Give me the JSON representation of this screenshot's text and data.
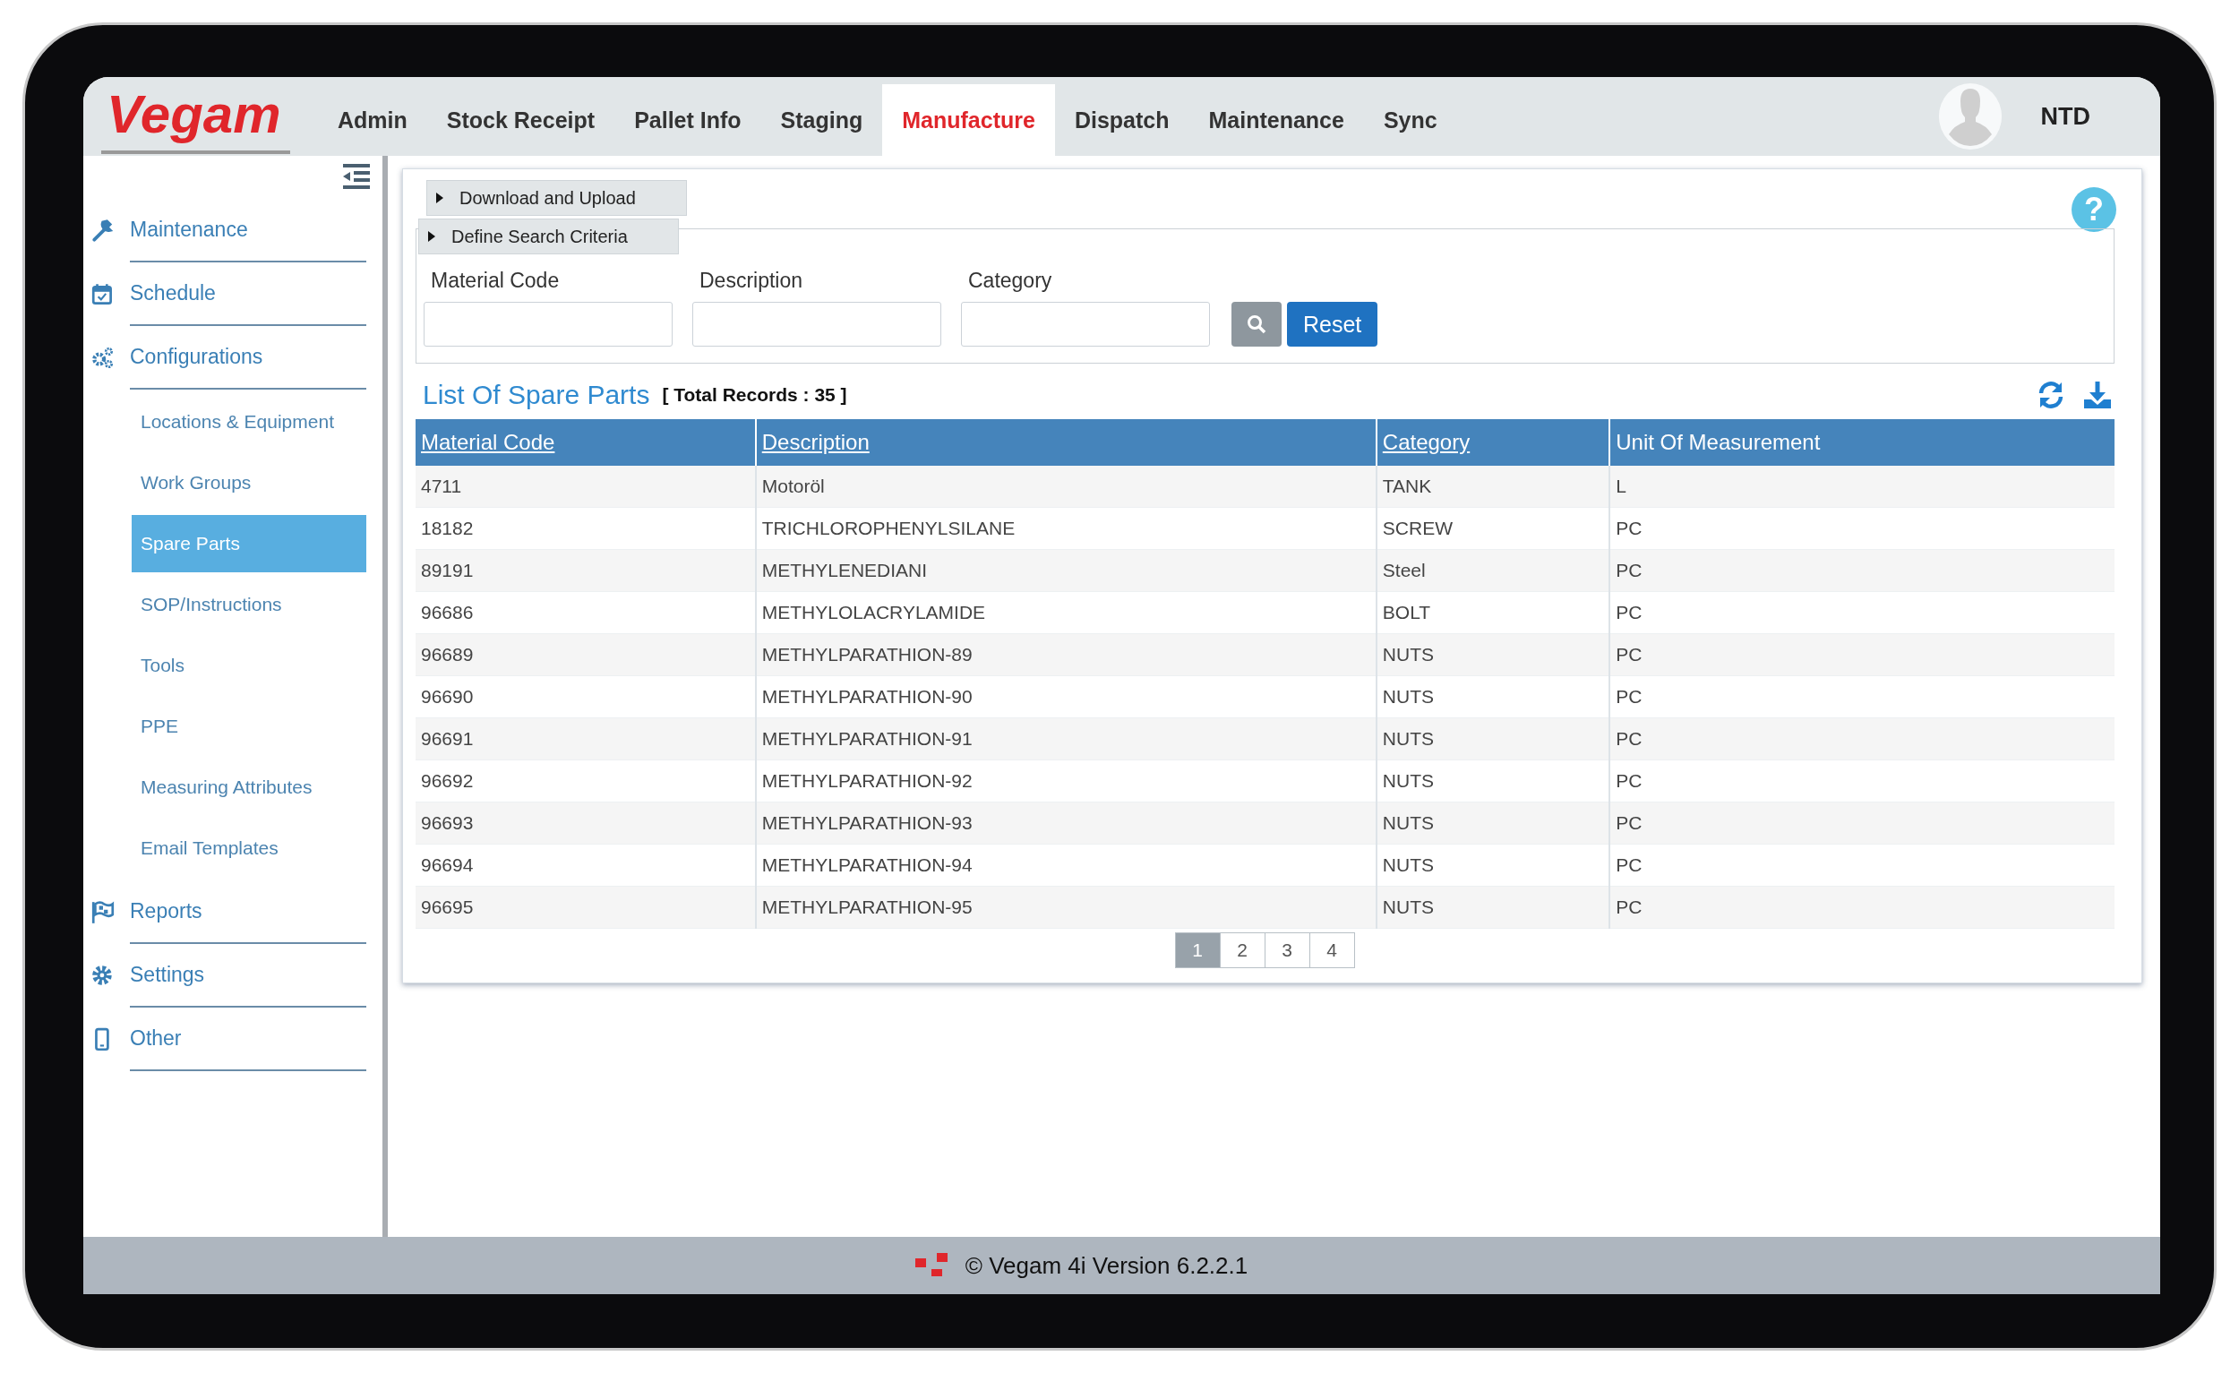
{
  "header": {
    "logo": "Vegam",
    "tabs": [
      {
        "label": "Admin",
        "selected": false
      },
      {
        "label": "Stock Receipt",
        "selected": false
      },
      {
        "label": "Pallet Info",
        "selected": false
      },
      {
        "label": "Staging",
        "selected": false
      },
      {
        "label": "Manufacture",
        "selected": true
      },
      {
        "label": "Dispatch",
        "selected": false
      },
      {
        "label": "Maintenance",
        "selected": false
      },
      {
        "label": "Sync",
        "selected": false
      }
    ],
    "user": "NTD"
  },
  "sidebar": {
    "items": [
      {
        "label": "Maintenance",
        "selected": false
      },
      {
        "label": "Schedule",
        "selected": false
      },
      {
        "label": "Configurations",
        "selected": false,
        "children": [
          {
            "label": "Locations & Equipment",
            "selected": false
          },
          {
            "label": "Work Groups",
            "selected": false
          },
          {
            "label": "Spare Parts",
            "selected": true
          },
          {
            "label": "SOP/Instructions",
            "selected": false
          },
          {
            "label": "Tools",
            "selected": false
          },
          {
            "label": "PPE",
            "selected": false
          },
          {
            "label": "Measuring Attributes",
            "selected": false
          },
          {
            "label": "Email Templates",
            "selected": false
          }
        ]
      },
      {
        "label": "Reports",
        "selected": false
      },
      {
        "label": "Settings",
        "selected": false
      },
      {
        "label": "Other",
        "selected": false
      }
    ]
  },
  "panels": [
    {
      "label": "Download and Upload"
    },
    {
      "label": "Define Search Criteria"
    }
  ],
  "search": {
    "fields": [
      {
        "label": "Material Code"
      },
      {
        "label": "Description"
      },
      {
        "label": "Category"
      }
    ],
    "reset_button": "Reset"
  },
  "list": {
    "title": "List Of Spare Parts",
    "total": "[ Total Records : 35 ]"
  },
  "table": {
    "columns": [
      {
        "label": "Material Code",
        "sortable": true
      },
      {
        "label": "Description",
        "sortable": true
      },
      {
        "label": "Category",
        "sortable": true
      },
      {
        "label": "Unit Of Measurement",
        "sortable": false
      }
    ],
    "rows": [
      [
        "4711",
        "Motoröl",
        "TANK",
        "L"
      ],
      [
        "18182",
        "TRICHLOROPHENYLSILANE",
        "SCREW",
        "PC"
      ],
      [
        "89191",
        "METHYLENEDIANI",
        "Steel",
        "PC"
      ],
      [
        "96686",
        "METHYLOLACRYLAMIDE",
        "BOLT",
        "PC"
      ],
      [
        "96689",
        "METHYLPARATHION-89",
        "NUTS",
        "PC"
      ],
      [
        "96690",
        "METHYLPARATHION-90",
        "NUTS",
        "PC"
      ],
      [
        "96691",
        "METHYLPARATHION-91",
        "NUTS",
        "PC"
      ],
      [
        "96692",
        "METHYLPARATHION-92",
        "NUTS",
        "PC"
      ],
      [
        "96693",
        "METHYLPARATHION-93",
        "NUTS",
        "PC"
      ],
      [
        "96694",
        "METHYLPARATHION-94",
        "NUTS",
        "PC"
      ],
      [
        "96695",
        "METHYLPARATHION-95",
        "NUTS",
        "PC"
      ]
    ]
  },
  "pagination": [
    {
      "label": "1",
      "selected": true
    },
    {
      "label": "2",
      "selected": false
    },
    {
      "label": "3",
      "selected": false
    },
    {
      "label": "4",
      "selected": false
    }
  ],
  "footer": "© Vegam 4i Version 6.2.2.1",
  "help_button": "?"
}
